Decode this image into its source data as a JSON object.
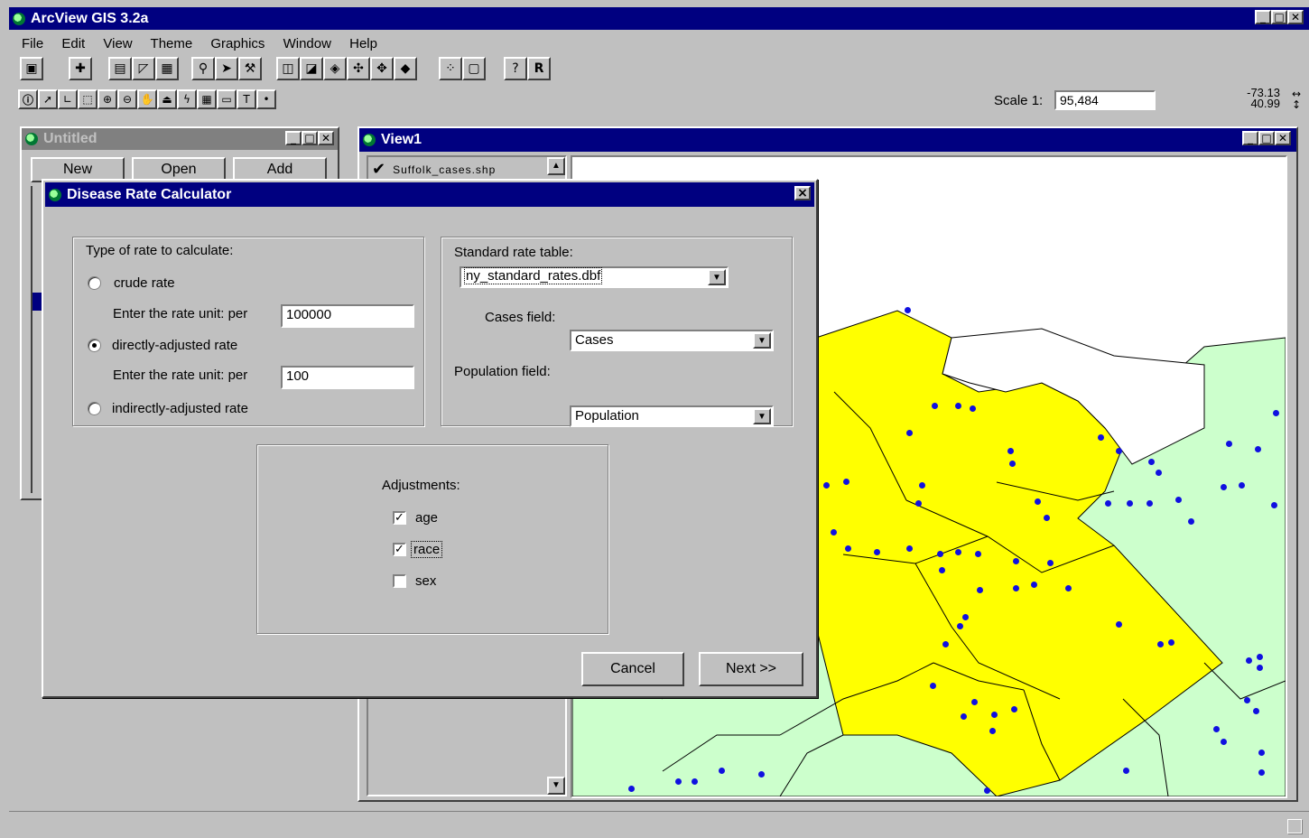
{
  "app": {
    "title": "ArcView GIS 3.2a"
  },
  "menu": [
    "File",
    "Edit",
    "View",
    "Theme",
    "Graphics",
    "Window",
    "Help"
  ],
  "toolbar": {
    "scale_label": "Scale 1:",
    "scale_value": "95,484",
    "coord_x": "-73.13",
    "coord_y": "40.99"
  },
  "project_window": {
    "title": "Untitled",
    "buttons": {
      "new": "New",
      "open": "Open",
      "add": "Add"
    }
  },
  "view_window": {
    "title": "View1",
    "theme_name": "Suffolk_cases.shp"
  },
  "dialog": {
    "title": "Disease Rate Calculator",
    "close": "×",
    "rate_type": {
      "label": "Type of rate to calculate:",
      "crude": "crude rate",
      "crude_unit_label": "Enter the rate unit:  per",
      "crude_unit_value": "100000",
      "direct": "directly-adjusted rate",
      "direct_unit_label": "Enter the rate unit:  per",
      "direct_unit_value": "100",
      "indirect": "indirectly-adjusted rate",
      "selected": "direct"
    },
    "standard": {
      "label": "Standard rate table:",
      "table_value": "ny_standard_rates.dbf",
      "cases_label": "Cases field:",
      "cases_value": "Cases",
      "population_label": "Population field:",
      "population_value": "Population"
    },
    "adjustments": {
      "label": "Adjustments:",
      "age": "age",
      "age_checked": true,
      "race": "race",
      "race_checked": true,
      "sex": "sex",
      "sex_checked": false
    },
    "buttons": {
      "cancel": "Cancel",
      "next": "Next >>"
    }
  },
  "colors": {
    "titlebar": "#000080",
    "map_yellow": "#ffff00",
    "map_green": "#ccffcc",
    "points": "#1010e0"
  }
}
